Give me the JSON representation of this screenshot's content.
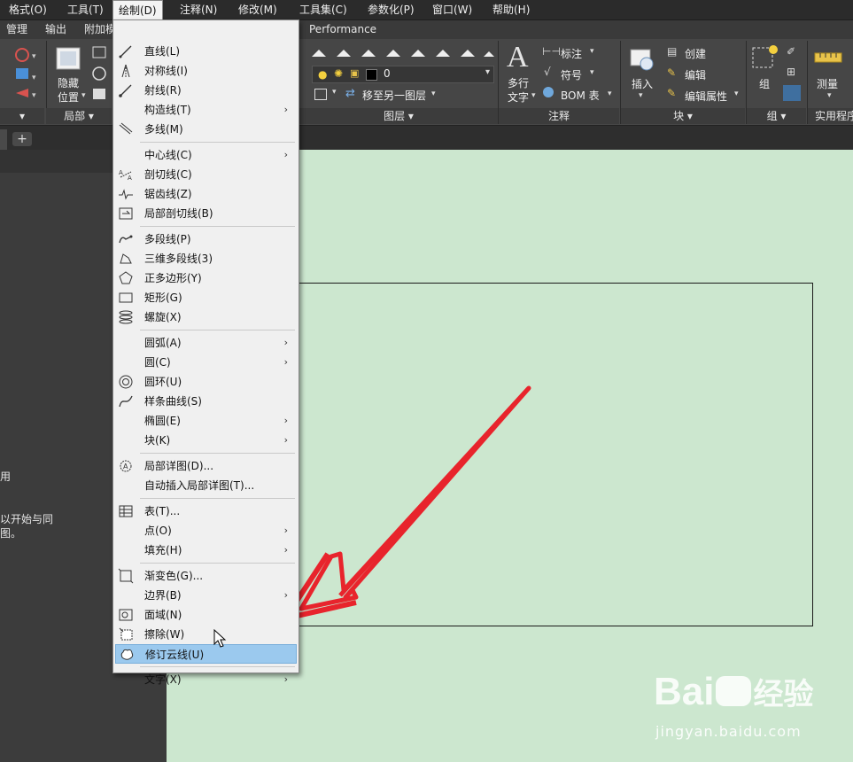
{
  "menubar": {
    "items": [
      "格式(O)",
      "工具(T)",
      "绘制(D)",
      "注释(N)",
      "修改(M)",
      "工具集(C)",
      "参数化(P)",
      "窗口(W)",
      "帮助(H)"
    ]
  },
  "tabs": [
    "管理",
    "输出",
    "附加模",
    "Performance"
  ],
  "ribbon": {
    "hide_label_1": "隐藏",
    "hide_label_2": "位置",
    "panel_local": "局部",
    "layer_value": "0",
    "move_layer": "移至另一图层",
    "panel_layer": "图层",
    "multiline_text_1": "多行",
    "multiline_text_2": "文字",
    "dimension": "标注",
    "symbol": "符号",
    "bom": "BOM 表",
    "panel_annotate": "注释",
    "insert": "插入",
    "create": "创建",
    "edit": "编辑",
    "edit_attr": "编辑属性",
    "panel_block": "块",
    "group": "组",
    "panel_group": "组",
    "measure": "测量",
    "panel_utility": "实用程序"
  },
  "left_panel": {
    "line1": "用",
    "line2": "以开始与同",
    "line3": "图。"
  },
  "draw_menu": {
    "items": [
      {
        "label": "直线(L)",
        "icon": "line-icon",
        "sub": false
      },
      {
        "label": "对称线(I)",
        "icon": "symmetry-line-icon",
        "sub": false
      },
      {
        "label": "射线(R)",
        "icon": "ray-icon",
        "sub": false
      },
      {
        "label": "构造线(T)",
        "icon": "",
        "sub": true
      },
      {
        "label": "多线(M)",
        "icon": "multiline-icon",
        "sub": false
      },
      {
        "label": "中心线(C)",
        "icon": "",
        "sub": true
      },
      {
        "label": "剖切线(C)",
        "icon": "section-line-icon",
        "sub": false
      },
      {
        "label": "锯齿线(Z)",
        "icon": "zigzag-line-icon",
        "sub": false
      },
      {
        "label": "局部剖切线(B)",
        "icon": "local-section-icon",
        "sub": false
      },
      {
        "label": "多段线(P)",
        "icon": "polyline-icon",
        "sub": false
      },
      {
        "label": "三维多段线(3)",
        "icon": "3d-polyline-icon",
        "sub": false
      },
      {
        "label": "正多边形(Y)",
        "icon": "polygon-icon",
        "sub": false
      },
      {
        "label": "矩形(G)",
        "icon": "rectangle-icon",
        "sub": false
      },
      {
        "label": "螺旋(X)",
        "icon": "helix-icon",
        "sub": false
      },
      {
        "label": "圆弧(A)",
        "icon": "",
        "sub": true
      },
      {
        "label": "圆(C)",
        "icon": "",
        "sub": true
      },
      {
        "label": "圆环(U)",
        "icon": "donut-icon",
        "sub": false
      },
      {
        "label": "样条曲线(S)",
        "icon": "spline-icon",
        "sub": false
      },
      {
        "label": "椭圆(E)",
        "icon": "",
        "sub": true
      },
      {
        "label": "块(K)",
        "icon": "",
        "sub": true
      },
      {
        "label": "局部详图(D)...",
        "icon": "detail-view-icon",
        "sub": false
      },
      {
        "label": "自动插入局部详图(T)...",
        "icon": "",
        "sub": false
      },
      {
        "label": "表(T)...",
        "icon": "table-icon",
        "sub": false
      },
      {
        "label": "点(O)",
        "icon": "",
        "sub": true
      },
      {
        "label": "填充(H)",
        "icon": "",
        "sub": true
      },
      {
        "label": "渐变色(G)...",
        "icon": "gradient-icon",
        "sub": false
      },
      {
        "label": "边界(B)",
        "icon": "",
        "sub": true
      },
      {
        "label": "面域(N)",
        "icon": "region-icon",
        "sub": false
      },
      {
        "label": "擦除(W)",
        "icon": "wipeout-icon",
        "sub": false
      },
      {
        "label": "修订云线(U)",
        "icon": "revision-cloud-icon",
        "sub": false
      },
      {
        "label": "文字(X)",
        "icon": "",
        "sub": true
      }
    ]
  },
  "watermark": {
    "brand": "Bai",
    "brand2": "经验",
    "url": "jingyan.baidu.com"
  },
  "colors": {
    "canvas_bg": "#cce7cf",
    "highlight": "#9bc9ee",
    "arrow_red": "#e8242c"
  }
}
